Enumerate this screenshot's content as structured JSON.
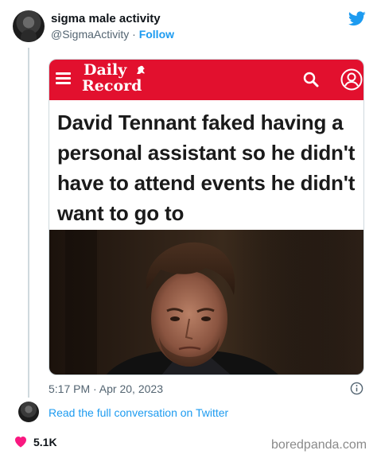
{
  "tweet": {
    "user": {
      "display_name": "sigma male activity",
      "handle": "@SigmaActivity",
      "separator": " · ",
      "follow_label": "Follow"
    },
    "timestamp": "5:17 PM · Apr 20, 2023",
    "conversation_link": "Read the full conversation on Twitter",
    "like_count": "5.1K"
  },
  "embedded_article": {
    "publication_line1": "Daily",
    "publication_line2": "Record",
    "headline": "David Tennant faked having a personal assistant so he didn't have to attend events he didn't want to go to"
  },
  "watermark": "boredpanda.com",
  "icons": {
    "brand": "twitter-bird-icon",
    "menu": "hamburger-menu-icon",
    "search": "search-icon",
    "account": "user-account-icon",
    "info": "info-icon",
    "like": "heart-icon"
  },
  "colors": {
    "twitter_blue": "#1d9bf0",
    "daily_record_red": "#e2102e",
    "heart_pink": "#f91880",
    "text_primary": "#0f1419",
    "text_secondary": "#536471"
  }
}
